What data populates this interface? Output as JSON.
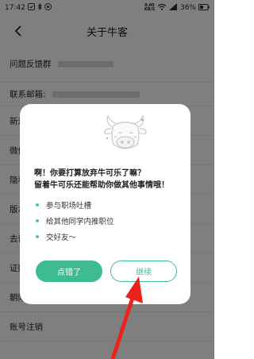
{
  "status_bar": {
    "time": "17:42",
    "net_speed_value": "0.00",
    "net_speed_unit": "KB/S",
    "battery": "36%"
  },
  "header": {
    "title": "关于牛客"
  },
  "settings": {
    "rows": [
      {
        "label": "问题反馈群"
      },
      {
        "label": "联系邮箱:"
      },
      {
        "label": "新浪"
      },
      {
        "label": "微信"
      },
      {
        "label": "隐私"
      },
      {
        "label": "版本"
      },
      {
        "label": "去评"
      },
      {
        "label": "证照"
      },
      {
        "label": "朝阳人力社保局:"
      },
      {
        "label": "账号注销"
      }
    ]
  },
  "dialog": {
    "heading_line1": "啊！你要打算放弃牛可乐了嘛？",
    "heading_line2": "留着牛可乐还能帮助你做其他事情哦！",
    "bullets": [
      "参与职场吐槽",
      "给其他同学内推职位",
      "交好友～"
    ],
    "primary_button": "点错了",
    "secondary_button": "继续"
  },
  "colors": {
    "accent": "#3dbd8f",
    "annotation": "#e8241d"
  }
}
